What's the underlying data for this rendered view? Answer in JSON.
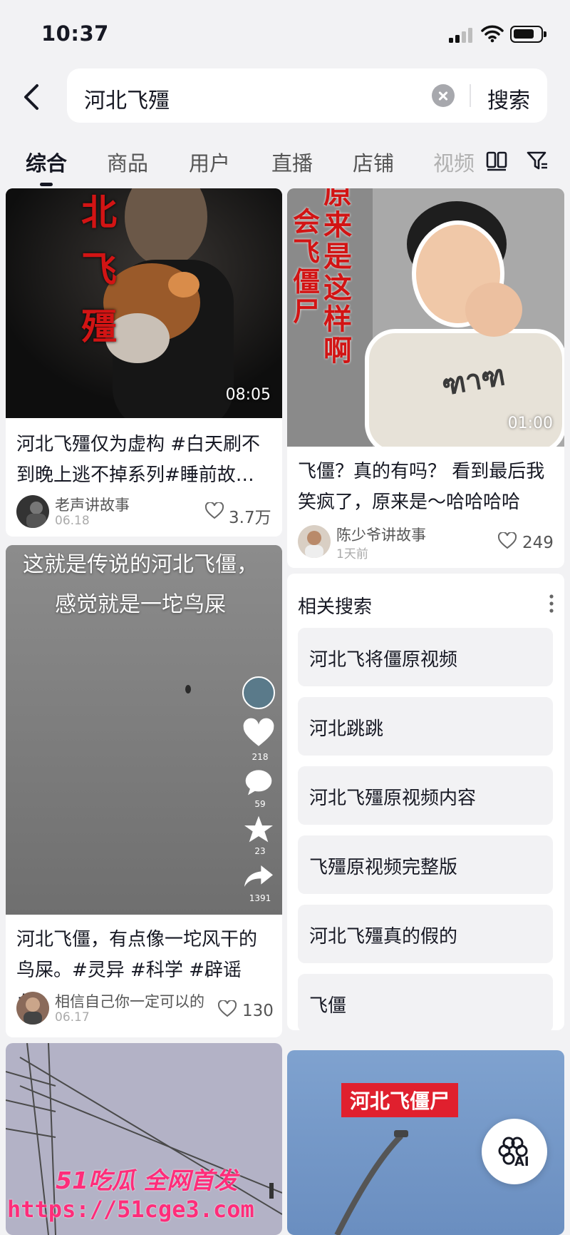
{
  "status": {
    "time": "10:37"
  },
  "search": {
    "query": "河北飞殭",
    "button": "搜索"
  },
  "tabs": [
    "综合",
    "商品",
    "用户",
    "直播",
    "店铺",
    "视频"
  ],
  "cards": [
    {
      "title": "河北飞殭仅为虚构 #白天刷不到晚上逃不掉系列#睡前故…",
      "duration": "08:05",
      "overlay": "北飞殭",
      "author": "老声讲故事",
      "date": "06.18",
      "likes": "3.7万"
    },
    {
      "title": "飞僵？真的有吗？ 看到最后我笑疯了，原来是～哈哈哈哈",
      "duration": "01:00",
      "overlay_a": "原来是这样啊",
      "overlay_b": "会飞僵尸",
      "author": "陈少爷讲故事",
      "date": "1天前",
      "likes": "249"
    },
    {
      "title": "河北飞僵，有点像一坨风干的鸟屎。#灵异 #科学 #辟谣 #…",
      "overlay": "这就是传说的河北飞僵，感觉就是一坨鸟屎",
      "side_counts": [
        "218",
        "59",
        "23",
        "1391"
      ],
      "author": "相信自己你一定可以的",
      "date": "06.17",
      "likes": "130"
    },
    {
      "overlay": "河北飞僵尸"
    }
  ],
  "related": {
    "heading": "相关搜索",
    "items": [
      "河北飞将僵原视频",
      "河北跳跳",
      "河北飞殭原视频内容",
      "飞殭原视频完整版",
      "河北飞殭真的假的",
      "飞僵"
    ]
  },
  "ai_button": "AI",
  "watermark": {
    "line1": "51吃瓜 全网首发",
    "line2": "https://51cge3.com"
  }
}
